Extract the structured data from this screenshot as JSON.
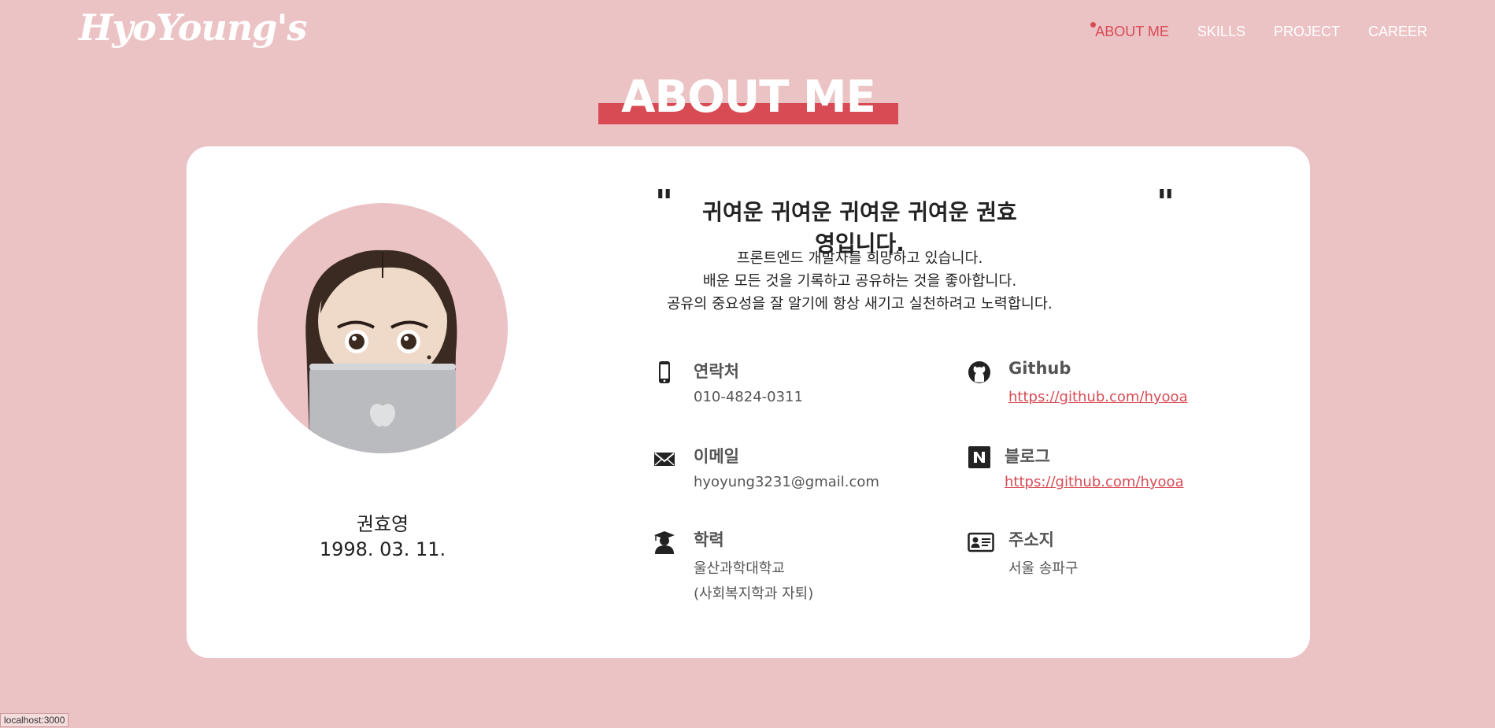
{
  "header": {
    "logo": "HyoYoung's",
    "nav": [
      {
        "label": "ABOUT ME",
        "active": true
      },
      {
        "label": "SKILLS",
        "active": false
      },
      {
        "label": "PROJECT",
        "active": false
      },
      {
        "label": "CAREER",
        "active": false
      }
    ]
  },
  "section": {
    "title": "ABOUT ME"
  },
  "profile": {
    "name": "권효영",
    "birth": "1998. 03. 11."
  },
  "intro": {
    "open_quote": "\"",
    "close_quote": "\"",
    "headline": "귀여운 귀여운 귀여운 귀여운 권효영입니다.",
    "lines": [
      "프론트엔드 개발자를 희망하고 있습니다.",
      "배운 모든 것을 기록하고 공유하는 것을 좋아합니다.",
      "공유의 중요성을 잘 알기에 항상 새기고 실천하려고 노력합니다."
    ]
  },
  "info": {
    "contact": {
      "label": "연락처",
      "value": "010-4824-0311",
      "icon": "phone-icon"
    },
    "github": {
      "label": "Github",
      "value": "https://github.com/hyooa",
      "icon": "github-icon"
    },
    "email": {
      "label": "이메일",
      "value": "hyoyung3231@gmail.com",
      "icon": "mail-icon"
    },
    "blog": {
      "label": "블로그",
      "value": "https://github.com/hyooa",
      "icon": "naver-icon"
    },
    "education": {
      "label": "학력",
      "value": "울산과학대학교",
      "value2": "(사회복지학과 자퇴)",
      "icon": "graduate-icon"
    },
    "address": {
      "label": "주소지",
      "value": "서울 송파구",
      "icon": "id-card-icon"
    }
  },
  "status_bar": {
    "url": "localhost:3000"
  },
  "colors": {
    "accent": "#d84b54",
    "background": "#ecc3c5",
    "card": "#ffffff"
  }
}
